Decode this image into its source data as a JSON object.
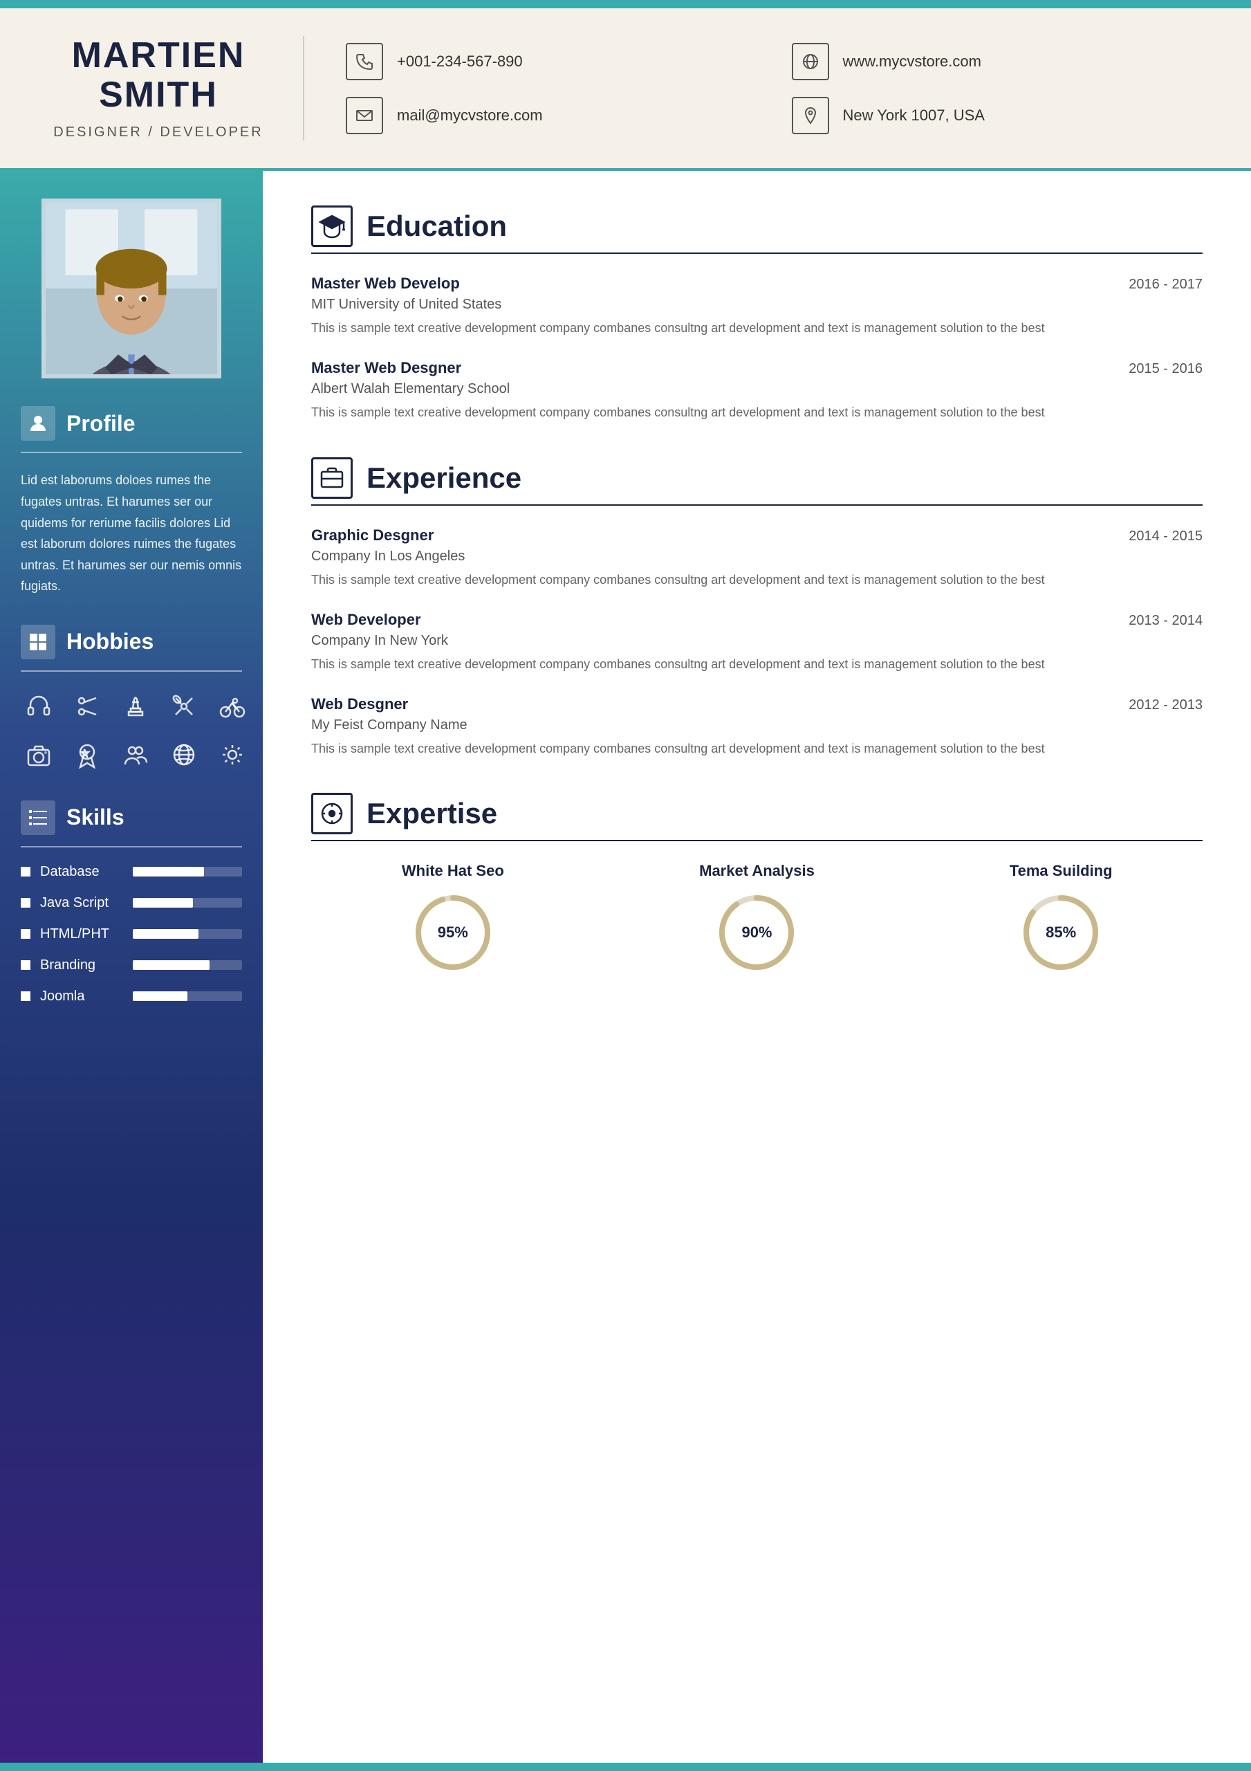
{
  "header": {
    "name_line1": "MARTIEN",
    "name_line2": "SMITH",
    "title": "DESIGNER / DEVELOPER",
    "phone": "+001-234-567-890",
    "website": "www.mycvstore.com",
    "email": "mail@mycvstore.com",
    "location": "New York 1007, USA"
  },
  "sidebar": {
    "profile_section_label": "Profile",
    "profile_text": "Lid est laborums doloes rumes the fugates untras. Et harumes ser our quidems for reriume facilis dolores Lid est laborum dolores ruimes the fugates untras. Et harumes ser our nemis omnis fugiats.",
    "hobbies_section_label": "Hobbies",
    "hobbies": [
      {
        "icon": "🎧",
        "name": "music-icon"
      },
      {
        "icon": "✂",
        "name": "craft-icon"
      },
      {
        "icon": "♟",
        "name": "chess-icon"
      },
      {
        "icon": "📡",
        "name": "broadcast-icon"
      },
      {
        "icon": "🚲",
        "name": "cycling-icon"
      },
      {
        "icon": "📷",
        "name": "photography-icon"
      },
      {
        "icon": "🏅",
        "name": "medal-icon"
      },
      {
        "icon": "👥",
        "name": "group-icon"
      },
      {
        "icon": "🌐",
        "name": "globe-icon"
      },
      {
        "icon": "⚙",
        "name": "settings-icon"
      }
    ],
    "skills_section_label": "Skills",
    "skills": [
      {
        "name": "Database",
        "percent": 65
      },
      {
        "name": "Java Script",
        "percent": 55
      },
      {
        "name": "HTML/PHT",
        "percent": 60
      },
      {
        "name": "Branding",
        "percent": 70
      },
      {
        "name": "Joomla",
        "percent": 50
      }
    ]
  },
  "education": {
    "section_label": "Education",
    "entries": [
      {
        "title": "Master Web Develop",
        "date": "2016 - 2017",
        "institution": "MIT University of United States",
        "description": "This is sample text creative development company combanes consultng art development and text is management solution to the best"
      },
      {
        "title": "Master Web Desgner",
        "date": "2015 - 2016",
        "institution": "Albert Walah Elementary School",
        "description": "This is sample text creative development company combanes consultng art development and text is management solution to the best"
      }
    ]
  },
  "experience": {
    "section_label": "Experience",
    "entries": [
      {
        "title": "Graphic Desgner",
        "date": "2014 - 2015",
        "company": "Company In Los Angeles",
        "description": "This is sample text creative development company combanes consultng art development and text is management solution to the best"
      },
      {
        "title": "Web Developer",
        "date": "2013 - 2014",
        "company": "Company In New York",
        "description": "This is sample text creative development company combanes consultng art development and text is management solution to the best"
      },
      {
        "title": "Web Desgner",
        "date": "2012 - 2013",
        "company": "My Feist Company Name",
        "description": "This is sample text creative development company combanes consultng art development and text is management solution to the best"
      }
    ]
  },
  "expertise": {
    "section_label": "Expertise",
    "items": [
      {
        "label": "White Hat Seo",
        "percent": 95
      },
      {
        "label": "Market Analysis",
        "percent": 90
      },
      {
        "label": "Tema Suilding",
        "percent": 85
      }
    ]
  }
}
